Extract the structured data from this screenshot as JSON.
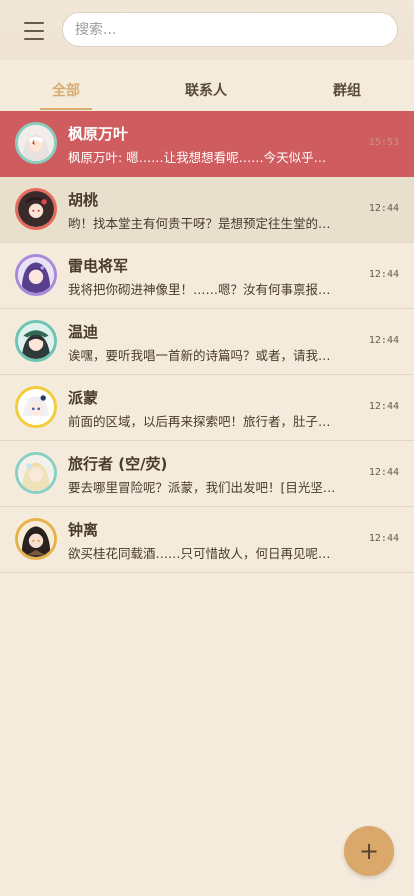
{
  "header": {
    "search_placeholder": "搜索..."
  },
  "tabs": [
    {
      "label": "全部"
    },
    {
      "label": "联系人"
    },
    {
      "label": "群组"
    }
  ],
  "conversations": [
    {
      "name": "枫原万叶",
      "preview": "枫原万叶: 嗯……让我想想看呢……今天似乎…",
      "time": "15:53",
      "avatar_color": "#8bcfc0"
    },
    {
      "name": "胡桃",
      "preview": "哟！找本堂主有何贵干呀？是想预定往生堂的…",
      "time": "12:44",
      "avatar_color": "#e86a5a"
    },
    {
      "name": "雷电将军",
      "preview": "我将把你砌进神像里！……嗯？汝有何事禀报…",
      "time": "12:44",
      "avatar_color": "#a98ad9"
    },
    {
      "name": "温迪",
      "preview": "诶嘿，要听我唱一首新的诗篇吗？或者，请我…",
      "time": "12:44",
      "avatar_color": "#6cc5b3"
    },
    {
      "name": "派蒙",
      "preview": "前面的区域，以后再来探索吧！旅行者，肚子…",
      "time": "12:44",
      "avatar_color": "#f2cc3a"
    },
    {
      "name": "旅行者 (空/荧)",
      "preview": "要去哪里冒险呢？派蒙，我们出发吧！[目光坚…",
      "time": "12:44",
      "avatar_color": "#8ad0c5"
    },
    {
      "name": "钟离",
      "preview": "欲买桂花同载酒……只可惜故人，何日再见呢…",
      "time": "12:44",
      "avatar_color": "#e8b24a"
    }
  ],
  "fab": {
    "label": "+"
  }
}
